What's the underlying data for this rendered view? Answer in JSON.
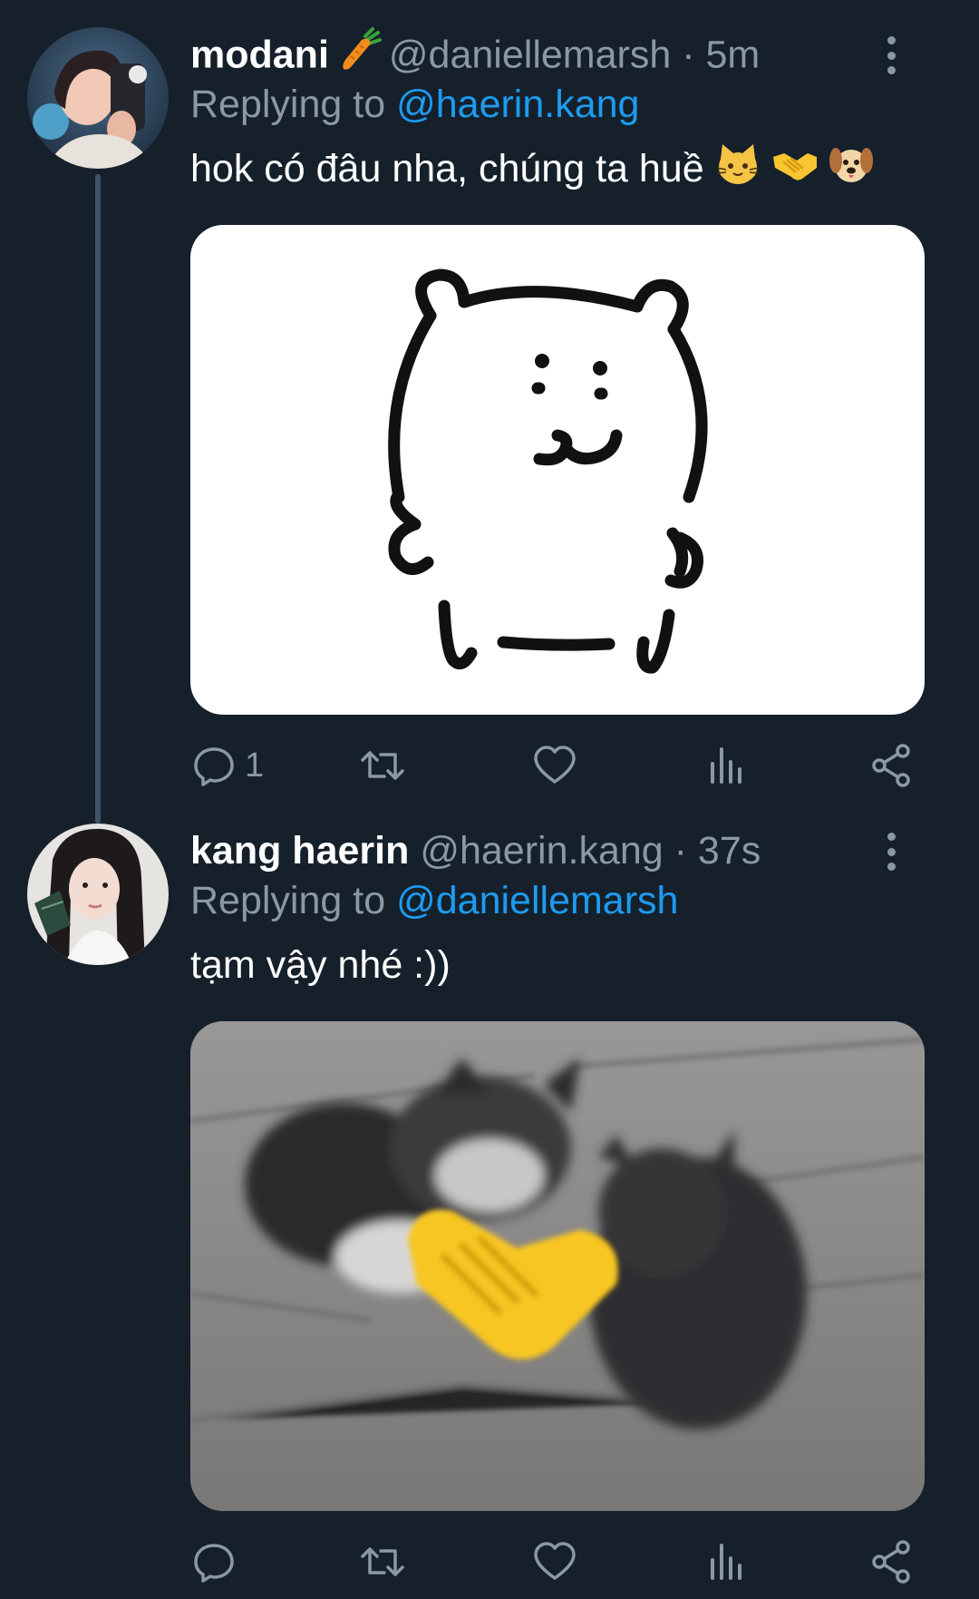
{
  "tweets": [
    {
      "display_name": "modani",
      "name_emoji": "carrot-icon",
      "handle": "@daniellemarsh",
      "separator": "·",
      "time": "5m",
      "replying_prefix": "Replying to",
      "replying_to": "@haerin.kang",
      "text": "hok có đâu nha, chúng ta huề",
      "text_emojis": [
        "cat-face-icon",
        "handshake-icon",
        "dog-face-icon"
      ],
      "media": "bear-drawing-image",
      "actions": {
        "reply_count": "1",
        "retweet_count": "",
        "like_count": ""
      }
    },
    {
      "display_name": "kang haerin",
      "handle": "@haerin.kang",
      "separator": "·",
      "time": "37s",
      "replying_prefix": "Replying to",
      "replying_to": "@daniellemarsh",
      "text": "tạm vậy nhé :))",
      "media": "kittens-handshake-image",
      "actions": {
        "reply_count": "",
        "retweet_count": "",
        "like_count": ""
      }
    }
  ],
  "colors": {
    "background": "#15202b",
    "secondary_text": "#8b98a5",
    "link": "#1d9bf0",
    "thread_line": "#3d5466"
  }
}
